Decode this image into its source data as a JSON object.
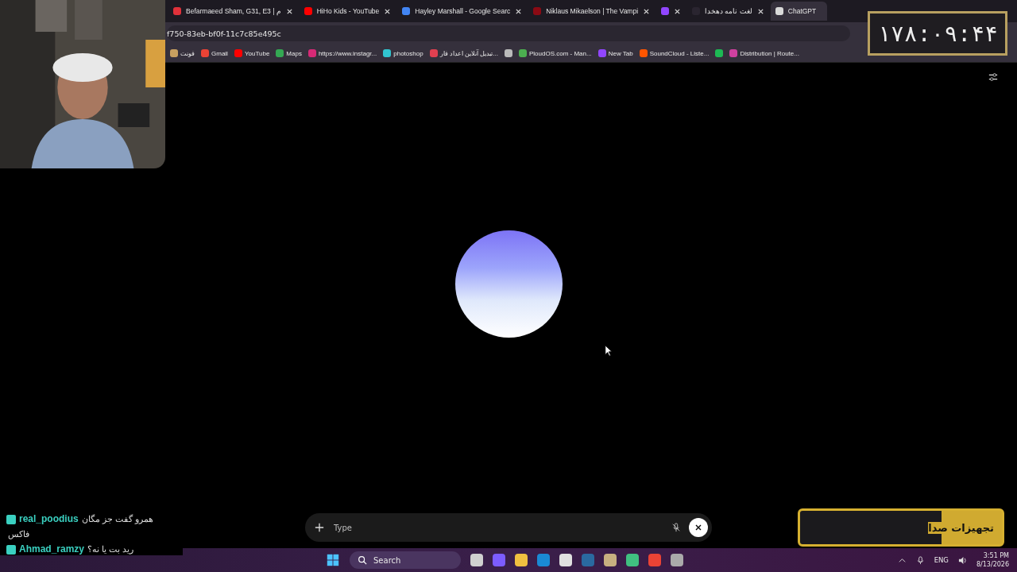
{
  "tabs": [
    {
      "title": "Befarmaeed Sham, G31, E3 | م",
      "color": "#e0313a",
      "selected": false
    },
    {
      "title": "HiHo Kids - YouTube",
      "color": "#ff0000",
      "selected": false
    },
    {
      "title": "Hayley Marshall - Google Searc",
      "color": "#4285f4",
      "selected": false
    },
    {
      "title": "Niklaus Mikaelson | The Vampi",
      "color": "#8b0a14",
      "selected": false
    },
    {
      "color": "#9146ff",
      "selected": false
    },
    {
      "title": "لغت نامه دهخدا",
      "color": "#2a2530",
      "selected": false
    },
    {
      "title": "ChatGPT",
      "color": "#d9d9d9",
      "selected": true
    }
  ],
  "address": "f750-83eb-bf0f-11c7c85e495c",
  "bookmarks": [
    {
      "label": "فونت",
      "color": "#c8a060"
    },
    {
      "label": "Gmail",
      "color": "#ea4335"
    },
    {
      "label": "YouTube",
      "color": "#ff0000"
    },
    {
      "label": "Maps",
      "color": "#34a853"
    },
    {
      "label": "https://www.instagr...",
      "color": "#d62976"
    },
    {
      "label": "photoshop",
      "color": "#31c5d0"
    },
    {
      "label": "تبدیل آنلاین اعداد فار...",
      "color": "#e04050"
    },
    {
      "color": "#bbbbbb"
    },
    {
      "label": "PloudOS.com - Man...",
      "color": "#4caf50"
    },
    {
      "label": "New Tab",
      "color": "#9146ff"
    },
    {
      "label": "SoundCloud - Liste...",
      "color": "#ff5500"
    },
    {
      "color": "#1db954"
    },
    {
      "label": "Distribution | Route...",
      "color": "#d040a0"
    }
  ],
  "composer": {
    "placeholder": "Type"
  },
  "timer": "۱۷۸:۰۹:۴۴",
  "chat": [
    {
      "user": "real_poodius",
      "message": "همرو گفت جز مگان",
      "extra": "فاکس"
    },
    {
      "user": "Ahmad_ramzy",
      "message": "رید بت یا نه؟"
    }
  ],
  "sponsor": "تجهیزات صدا",
  "taskbar": {
    "search": "Search",
    "language": "ENG",
    "time": "3:51 PM",
    "date": "8/13/2026"
  }
}
